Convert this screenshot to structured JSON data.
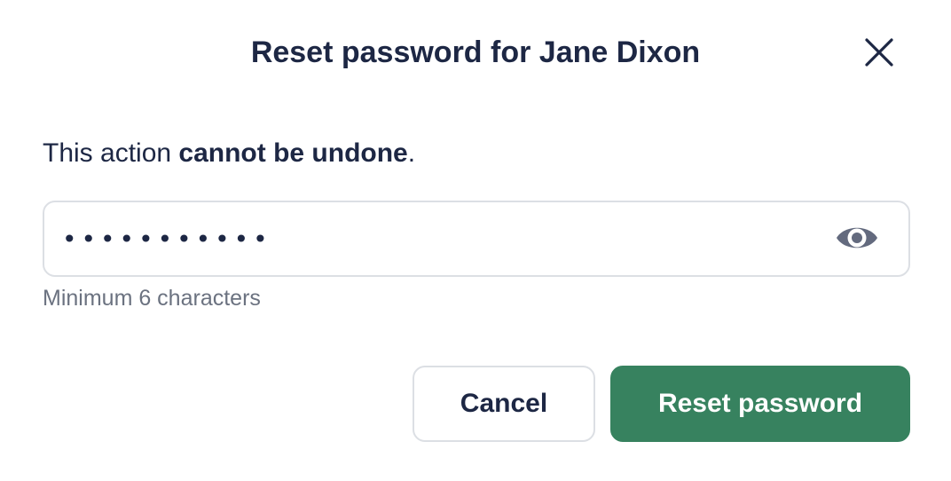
{
  "dialog": {
    "title": "Reset password for Jane Dixon",
    "close_icon": "close-icon"
  },
  "warning": {
    "prefix": "This action ",
    "emphasis": "cannot be undone",
    "suffix": "."
  },
  "password": {
    "masked_value": "•••••••••••",
    "toggle_icon": "eye-icon",
    "helper": "Minimum 6 characters"
  },
  "actions": {
    "cancel_label": "Cancel",
    "reset_label": "Reset password",
    "reset_color": "#37825f"
  }
}
